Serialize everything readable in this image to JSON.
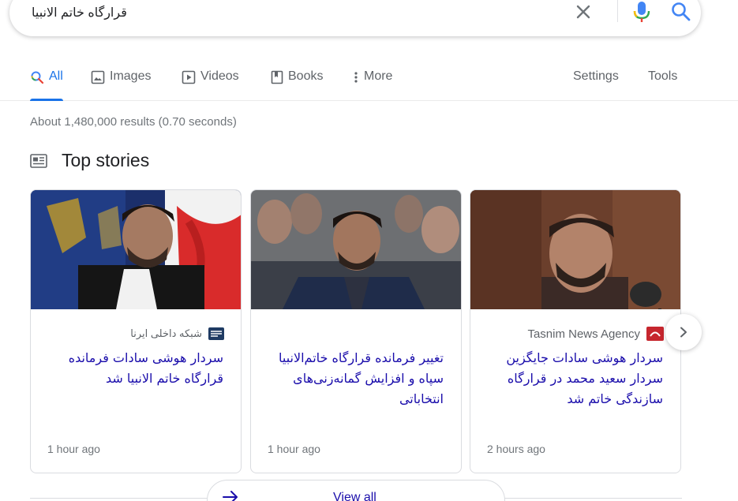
{
  "search": {
    "query": "قرارگاه خاتم الانبیا",
    "icons": [
      "close-icon",
      "microphone-icon",
      "search-icon"
    ]
  },
  "tabs": [
    {
      "label": "All",
      "icon": "search-icon",
      "active": true
    },
    {
      "label": "Images",
      "icon": "image-icon"
    },
    {
      "label": "Videos",
      "icon": "play-icon"
    },
    {
      "label": "Books",
      "icon": "book-icon"
    },
    {
      "label": "More",
      "icon": "more-vert-icon"
    },
    {
      "label": "Settings"
    },
    {
      "label": "Tools"
    }
  ],
  "result_stats": "About 1,480,000 results (0.70 seconds)",
  "top_stories": {
    "title": "Top stories",
    "cards": [
      {
        "source": "شبکه داخلی ایرنا",
        "headline": "سردار هوشی سادات فرمانده قرارگاه خاتم الانبیا شد",
        "age": "1 hour ago"
      },
      {
        "source": "",
        "headline": "تغییر فرمانده قرارگاه خاتم‌الانبیا سپاه و افزایش گمانه‌زنی‌های انتخاباتی",
        "age": "1 hour ago"
      },
      {
        "source": "Tasnim News Agency",
        "headline": "سردار هوشی سادات جایگزین سردار سعید محمد در قرارگاه سازندگی خاتم شد",
        "age": "2 hours ago"
      }
    ],
    "view_all": "View all"
  },
  "colors": {
    "accent": "#1a73e8",
    "link": "#1a0dab",
    "muted": "#70757a"
  }
}
